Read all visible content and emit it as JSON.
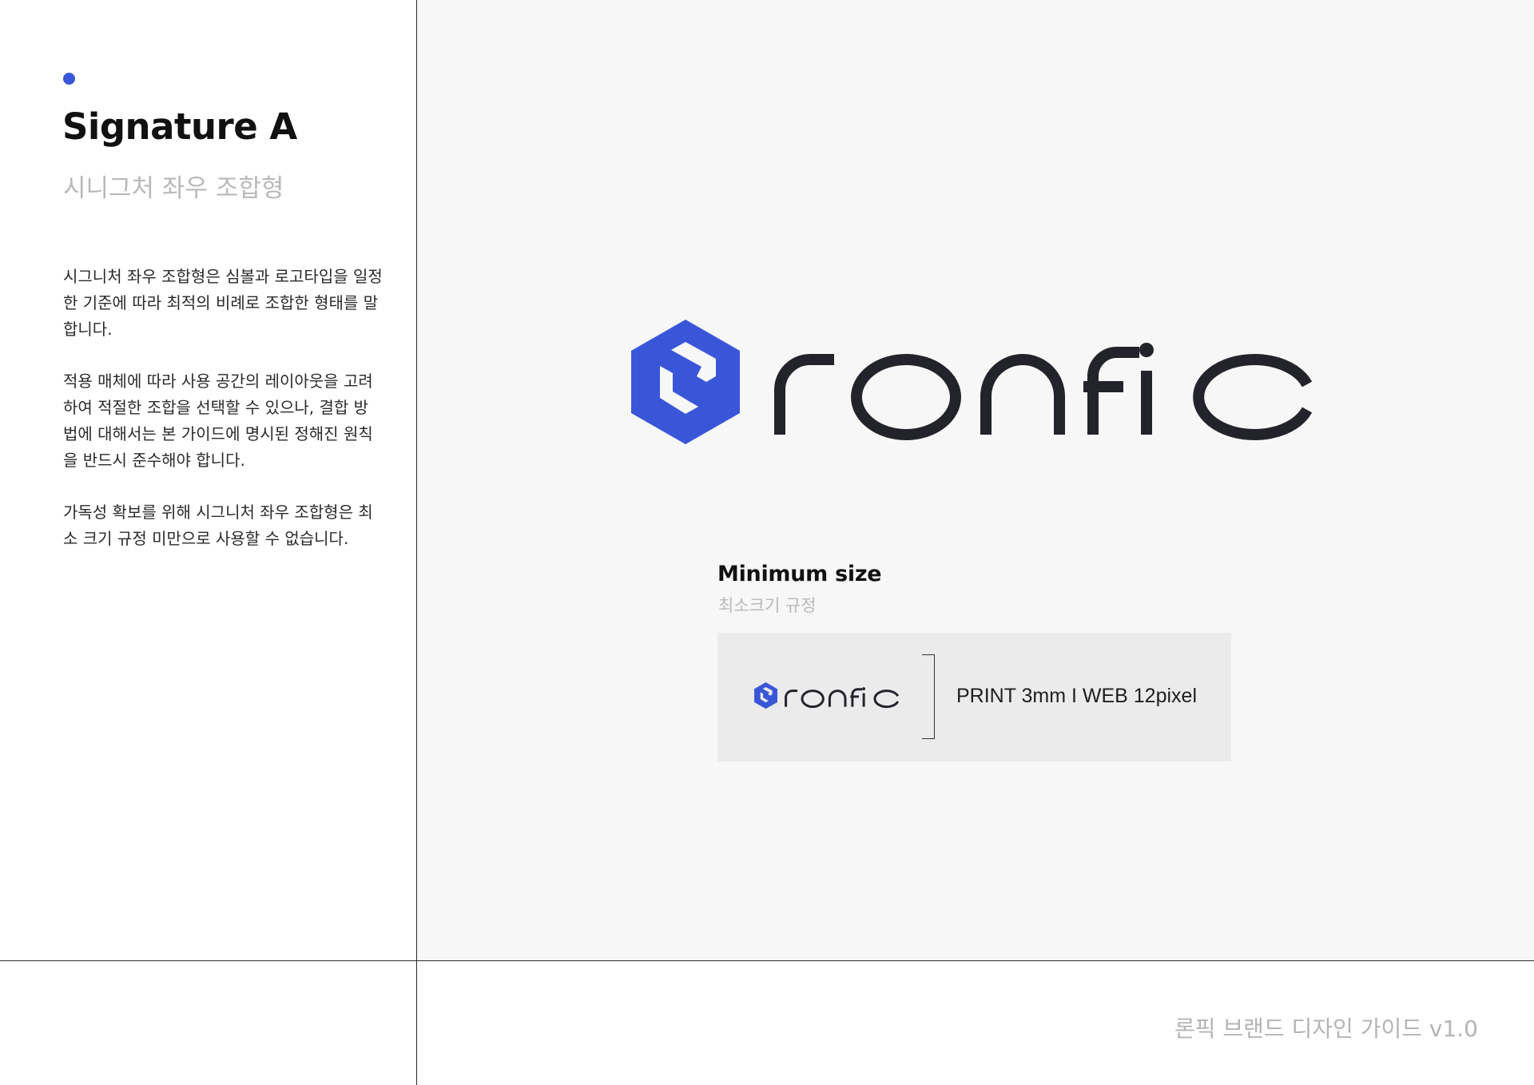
{
  "section": {
    "title": "Signature A",
    "subtitle": "시니그처 좌우 조합형"
  },
  "description": {
    "paragraph_1": "시그니처 좌우 조합형은 심볼과 로고타입을 일정한 기준에 따라 최적의 비례로 조합한 형태를 말합니다.",
    "paragraph_2": "적용 매체에 따라 사용 공간의 레이아웃을 고려하여 적절한 조합을 선택할 수 있으나, 결합 방법에 대해서는 본 가이드에 명시된 정해진 원칙을 반드시 준수해야 합니다.",
    "paragraph_3": "가독성 확보를 위해 시그니처 좌우 조합형은 최소 크기 규정 미만으로 사용할 수 없습니다."
  },
  "logo": {
    "wordmark": "ronfic",
    "symbol_color": "#3a56d8",
    "wordmark_color": "#23232b"
  },
  "minimum_size": {
    "title": "Minimum size",
    "subtitle": "최소크기 규정",
    "spec": "PRINT 3mm I WEB 12pixel"
  },
  "footer": {
    "guide_label": "론픽 브랜드 디자인 가이드 v1.0"
  },
  "colors": {
    "accent": "#3a56d8",
    "panel_background": "#f7f7f7",
    "box_background": "#ebebeb",
    "muted_text": "#b9b9b9"
  }
}
